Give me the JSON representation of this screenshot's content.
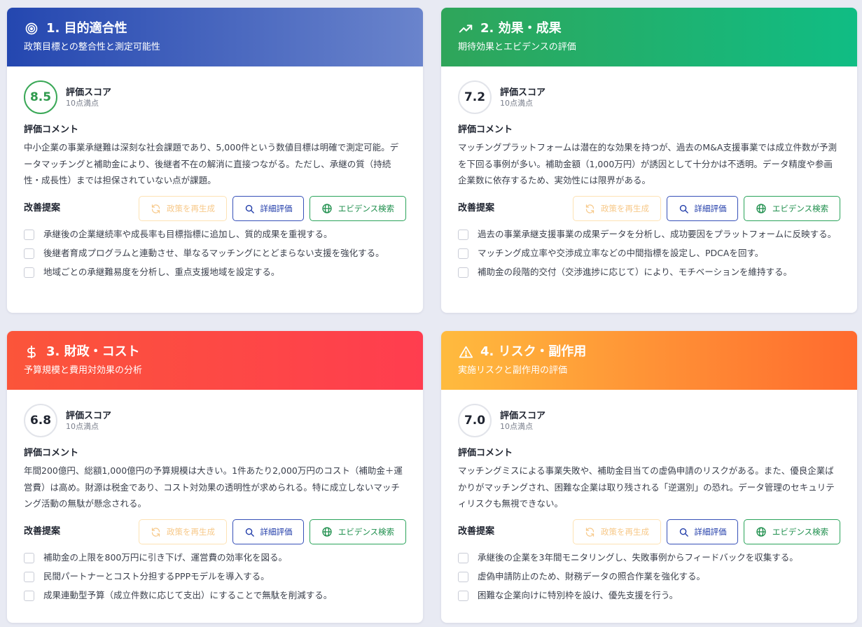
{
  "common": {
    "score_label": "評価スコア",
    "score_max": "10点満点",
    "comment_label": "評価コメント",
    "suggest_label": "改善提案",
    "regen_label": "政策を再生成",
    "detail_label": "詳細評価",
    "evidence_label": "エビデンス検索"
  },
  "colors": {
    "card1_gradient": [
      "#2447b0",
      "#6a84cc"
    ],
    "card2_gradient": [
      "#2fa55a",
      "#10bd84"
    ],
    "card3_gradient": [
      "#fb553a",
      "#ff3d4f"
    ],
    "card4_gradient": [
      "#ffbb3e",
      "#ff6a2e"
    ],
    "score_high": "#2e9a4c"
  },
  "cards": [
    {
      "icon": "target-icon",
      "title": "1. 目的適合性",
      "subtitle": "政策目標との整合性と測定可能性",
      "score": "8.5",
      "comment": "中小企業の事業承継難は深刻な社会課題であり、5,000件という数値目標は明確で測定可能。データマッチングと補助金により、後継者不在の解消に直接つながる。ただし、承継の質（持続性・成長性）までは担保されていない点が課題。",
      "suggestions": [
        "承継後の企業継続率や成長率も目標指標に追加し、質的成果を重視する。",
        "後継者育成プログラムと連動させ、単なるマッチングにとどまらない支援を強化する。",
        "地域ごとの承継難易度を分析し、重点支援地域を設定する。"
      ]
    },
    {
      "icon": "trending-up-icon",
      "title": "2. 効果・成果",
      "subtitle": "期待効果とエビデンスの評価",
      "score": "7.2",
      "comment": "マッチングプラットフォームは潜在的な効果を持つが、過去のM&A支援事業では成立件数が予測を下回る事例が多い。補助金額（1,000万円）が誘因として十分かは不透明。データ精度や参画企業数に依存するため、実効性には限界がある。",
      "suggestions": [
        "過去の事業承継支援事業の成果データを分析し、成功要因をプラットフォームに反映する。",
        "マッチング成立率や交渉成立率などの中間指標を設定し、PDCAを回す。",
        "補助金の段階的交付（交渉進捗に応じて）により、モチベーションを維持する。"
      ]
    },
    {
      "icon": "dollar-icon",
      "title": "3. 財政・コスト",
      "subtitle": "予算規模と費用対効果の分析",
      "score": "6.8",
      "comment": "年間200億円、総額1,000億円の予算規模は大きい。1件あたり2,000万円のコスト（補助金＋運営費）は高め。財源は税金であり、コスト対効果の透明性が求められる。特に成立しないマッチング活動の無駄が懸念される。",
      "suggestions": [
        "補助金の上限を800万円に引き下げ、運営費の効率化を図る。",
        "民間パートナーとコスト分担するPPPモデルを導入する。",
        "成果連動型予算（成立件数に応じて支出）にすることで無駄を削減する。"
      ]
    },
    {
      "icon": "warning-icon",
      "title": "4. リスク・副作用",
      "subtitle": "実施リスクと副作用の評価",
      "score": "7.0",
      "comment": "マッチングミスによる事業失敗や、補助金目当ての虚偽申請のリスクがある。また、優良企業ばかりがマッチングされ、困難な企業は取り残される「逆選別」の恐れ。データ管理のセキュリティリスクも無視できない。",
      "suggestions": [
        "承継後の企業を3年間モニタリングし、失敗事例からフィードバックを収集する。",
        "虚偽申請防止のため、財務データの照合作業を強化する。",
        "困難な企業向けに特別枠を設け、優先支援を行う。"
      ]
    }
  ]
}
